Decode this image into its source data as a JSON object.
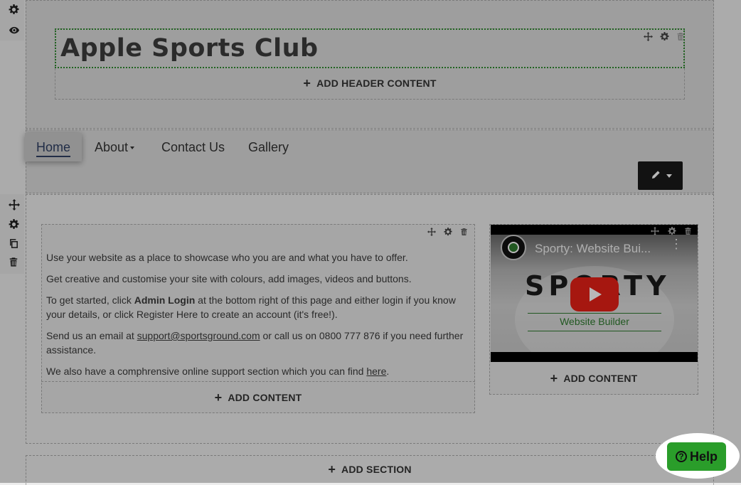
{
  "header": {
    "site_title": "Apple Sports Club",
    "add_header_content_label": "ADD HEADER CONTENT"
  },
  "nav": {
    "items": [
      {
        "label": "Home",
        "active": true
      },
      {
        "label": "About",
        "has_dropdown": true
      },
      {
        "label": "Contact Us"
      },
      {
        "label": "Gallery"
      }
    ]
  },
  "content": {
    "paragraph_1": "Use your website as a place to showcase who you are and what you have to offer.",
    "paragraph_2": "Get creative and customise your site with colours, add images, videos and buttons.",
    "paragraph_3_prefix": "To get started, click ",
    "paragraph_3_bold": "Admin Login",
    "paragraph_3_suffix": " at the bottom right of this page and either login if you know your details, or click Register Here to create an account (it's free!).",
    "paragraph_4_prefix": "Send us an email at ",
    "paragraph_4_link": "support@sportsground.com",
    "paragraph_4_suffix": " or call us on 0800 777 876 if you need further assistance.",
    "paragraph_5_prefix": "We also have a comphrensive online support section which you can find ",
    "paragraph_5_link": "here",
    "paragraph_5_suffix": ".",
    "add_content_label": "ADD CONTENT"
  },
  "video": {
    "title": "Sporty: Website Bui...",
    "logo_text": "SPORTY",
    "logo_sub": "Website Builder",
    "add_content_label": "ADD CONTENT"
  },
  "section": {
    "add_section_label": "ADD SECTION"
  },
  "help": {
    "label": "Help"
  },
  "icons": {
    "gear": "gear-icon",
    "eye": "eye-icon",
    "move": "move-icon",
    "copy": "copy-icon",
    "trash": "trash-icon",
    "pencil": "pencil-icon",
    "play": "play-icon"
  },
  "colors": {
    "title_outline": "#2e8b2e",
    "help_button": "#2a9d2a",
    "youtube_red": "#e62117",
    "edit_button": "#1a1a1a"
  }
}
